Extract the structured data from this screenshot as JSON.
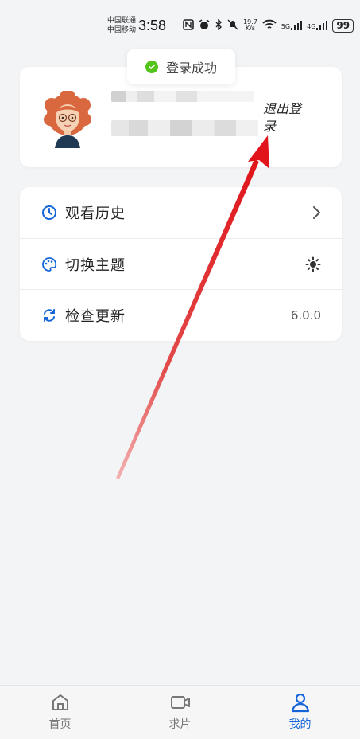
{
  "status_bar": {
    "carrier_1": "中国联通",
    "carrier_2": "中国移动",
    "time": "3:58",
    "net_speed_value": "19.7",
    "net_speed_unit": "K/s",
    "network_1": "5G",
    "network_2": "4G",
    "battery": "99"
  },
  "toast": {
    "message": "登录成功"
  },
  "profile": {
    "logout_label": "退出登录"
  },
  "menu": {
    "items": [
      {
        "label": "观看历史",
        "icon": "clock-icon",
        "right": "chevron-right-icon"
      },
      {
        "label": "切换主题",
        "icon": "palette-icon",
        "right": "sun-icon"
      },
      {
        "label": "检查更新",
        "icon": "refresh-icon",
        "right_text": "6.0.0"
      }
    ]
  },
  "bottom_nav": {
    "items": [
      {
        "label": "首页",
        "icon": "home-icon"
      },
      {
        "label": "求片",
        "icon": "video-camera-icon"
      },
      {
        "label": "我的",
        "icon": "user-icon",
        "active": true
      }
    ]
  },
  "colors": {
    "accent": "#1565d8",
    "success": "#52c41a",
    "annotation": "#e0141a",
    "background": "#f3f4f6"
  }
}
